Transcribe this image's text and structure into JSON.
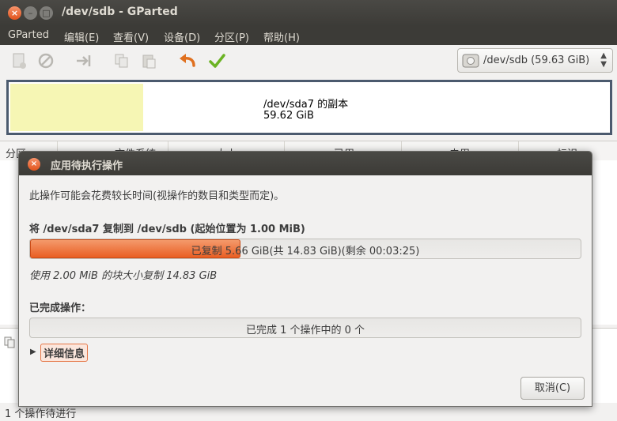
{
  "window": {
    "title": "/dev/sdb - GParted"
  },
  "menu": [
    "GParted",
    "编辑(E)",
    "查看(V)",
    "设备(D)",
    "分区(P)",
    "帮助(H)"
  ],
  "device_selector": {
    "value": "/dev/sdb   (59.63 GiB)"
  },
  "disk_map": {
    "name": "/dev/sda7 的副本",
    "size": "59.62 GiB",
    "partition_color": "#f6f6b4"
  },
  "partition_list": {
    "headers": [
      "分区",
      "文件系统",
      "大小",
      "已用",
      "未用",
      "标识"
    ]
  },
  "status_bar": {
    "text": "1 个操作待进行"
  },
  "dialog": {
    "title": "应用待执行操作",
    "intro": "此操作可能会花费较长时间(视操作的数目和类型而定)。",
    "current_op": "将 /dev/sda7 复制到 /dev/sdb (起始位置为 1.00 MiB)",
    "progress_text": "已复制 5.66 GiB(共 14.83 GiB)(剩余 00:03:25)",
    "progress_fraction": 0.382,
    "block_info": "使用 2.00 MiB 的块大小复制 14.83 GiB",
    "completed_label": "已完成操作：",
    "completed_text": "已完成 1 个操作中的 0 个",
    "completed_fraction": 0,
    "details_label": "详细信息",
    "cancel_label": "取消(C)"
  },
  "colors": {
    "accent": "#e95e23",
    "titlebar": "#3c3b37"
  }
}
